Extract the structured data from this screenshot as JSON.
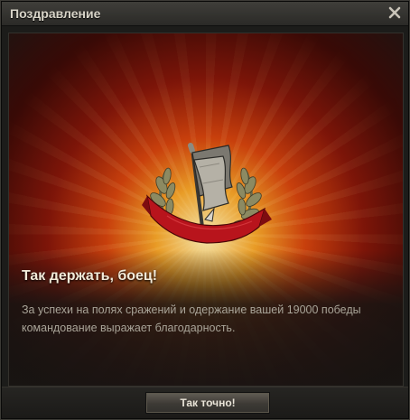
{
  "window": {
    "title": "Поздравление",
    "close_icon": "close-icon"
  },
  "award": {
    "emblem_icon": "banner-laurel-emblem-icon",
    "heading": "Так держать, боец!",
    "message": "За успехи на полях сражений и одержание вашей 19000 победы командование выражает благодарность."
  },
  "footer": {
    "ok_label": "Так точно!"
  },
  "colors": {
    "glow_core": "#fff0b4",
    "glow_orange": "#ffaa28",
    "glow_red": "#e6460a",
    "ribbon_red": "#b8141c"
  }
}
